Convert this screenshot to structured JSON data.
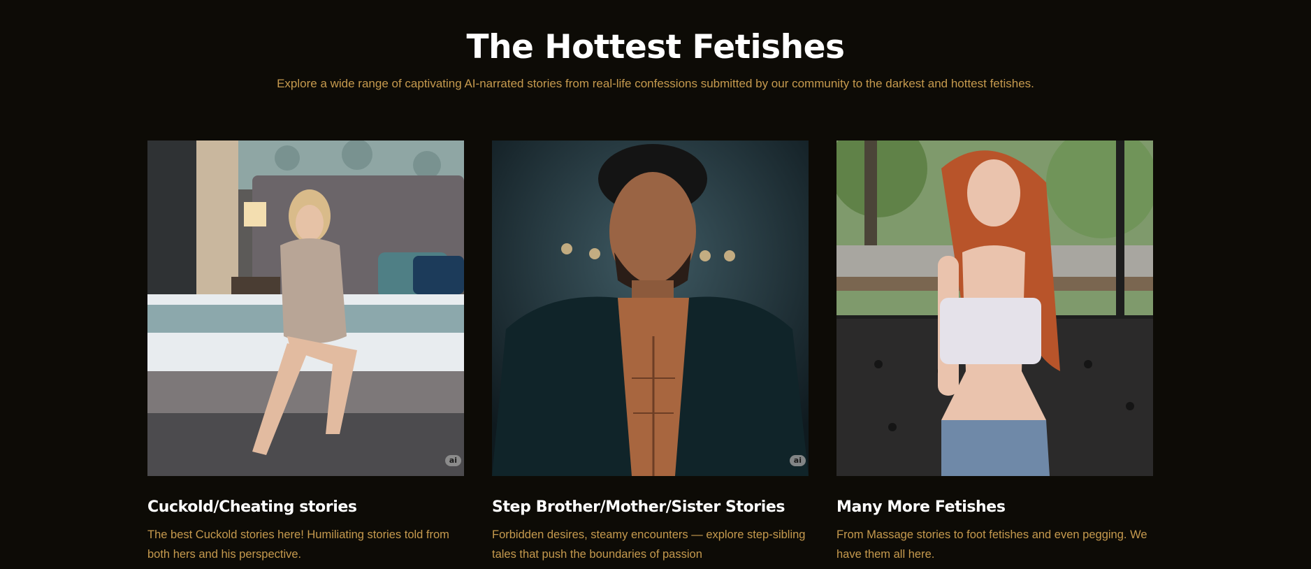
{
  "header": {
    "title": "The Hottest Fetishes",
    "subtitle": "Explore a wide range of captivating AI-narrated stories from real-life confessions submitted by our community to the darkest and hottest fetishes."
  },
  "cards": [
    {
      "title": "Cuckold/Cheating stories",
      "description": "The best Cuckold stories here! Humiliating stories told from both hers and his perspective.",
      "badge": "ai"
    },
    {
      "title": "Step Brother/Mother/Sister Stories",
      "description": "Forbidden desires, steamy encounters — explore step-sibling tales that push the boundaries of passion",
      "badge": "ai"
    },
    {
      "title": "Many More Fetishes",
      "description": "From Massage stories to foot fetishes and even pegging. We have them all here."
    }
  ],
  "colors": {
    "background": "#0d0b06",
    "title": "#ffffff",
    "accent_text": "#c69a4e"
  }
}
